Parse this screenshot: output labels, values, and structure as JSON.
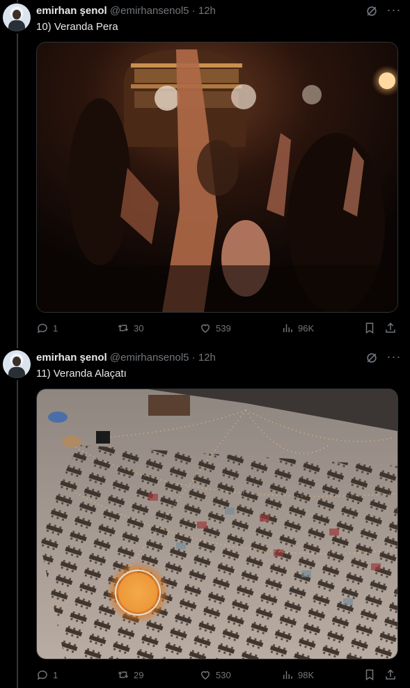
{
  "tweets": [
    {
      "author_name": "emirhan şenol",
      "handle": "@emirhansenol5",
      "separator": "·",
      "time": "12h",
      "text": "10) Veranda Pera",
      "media_description": "nightclub-crowd-photo",
      "stats": {
        "replies": "1",
        "reposts": "30",
        "likes": "539",
        "views": "96K"
      }
    },
    {
      "author_name": "emirhan şenol",
      "handle": "@emirhansenol5",
      "separator": "·",
      "time": "12h",
      "text": "11) Veranda Alaçatı",
      "media_description": "aerial-outdoor-dining-photo",
      "stats": {
        "replies": "1",
        "reposts": "29",
        "likes": "530",
        "views": "98K"
      }
    }
  ],
  "icons": {
    "reply": "reply-icon",
    "repost": "repost-icon",
    "like": "heart-icon",
    "views": "views-icon",
    "bookmark": "bookmark-icon",
    "share": "share-icon",
    "grok": "grok-icon",
    "more": "more-icon"
  },
  "colors": {
    "background": "#000000",
    "text": "#e7e9ea",
    "muted": "#71767b",
    "border": "#2f3336"
  }
}
